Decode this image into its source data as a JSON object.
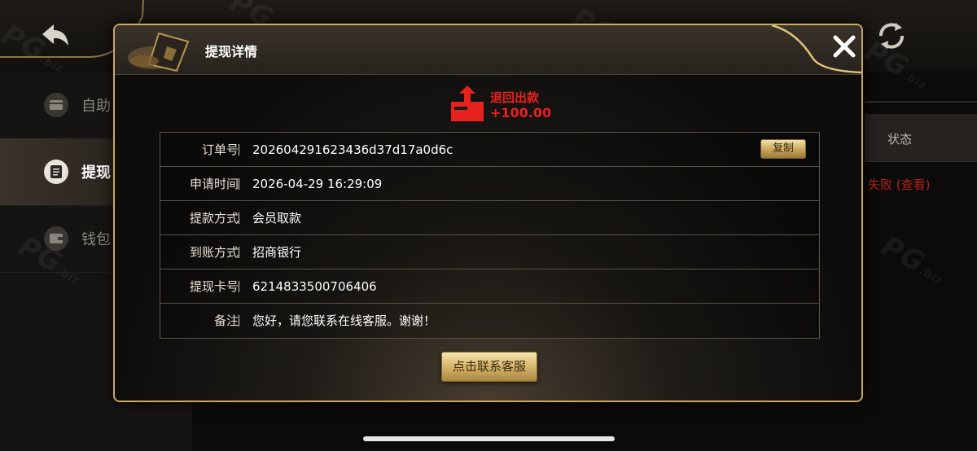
{
  "background": {
    "sidebar": {
      "items": [
        {
          "label": "自助",
          "icon": "card-icon",
          "active": false
        },
        {
          "label": "提现",
          "icon": "document-icon",
          "active": true
        },
        {
          "label": "钱包",
          "icon": "wallet-icon",
          "active": false
        }
      ]
    },
    "table": {
      "status_header": "状态",
      "status_value": "失败 (查看)"
    },
    "watermark_text": "PG",
    "watermark_sub": ".biz"
  },
  "modal": {
    "title": "提现详情",
    "refund": {
      "label": "退回出款",
      "amount": "+100.00",
      "icon": "upload-tray-icon"
    },
    "rows": [
      {
        "label": "订单号",
        "value": "202604291623436d37d17a0d6c"
      },
      {
        "label": "申请时间",
        "value": "2026-04-29 16:29:09"
      },
      {
        "label": "提款方式",
        "value": "会员取款"
      },
      {
        "label": "到账方式",
        "value": "招商银行"
      },
      {
        "label": "提现卡号",
        "value": "6214833500706406"
      },
      {
        "label": "备注",
        "value": "您好，请您联系在线客服。谢谢！"
      }
    ],
    "copy_label": "复制",
    "contact_label": "点击联系客服"
  },
  "colors": {
    "accent_gold": "#c9a862",
    "refund_red": "#e5221d",
    "status_fail": "#b3241d"
  }
}
